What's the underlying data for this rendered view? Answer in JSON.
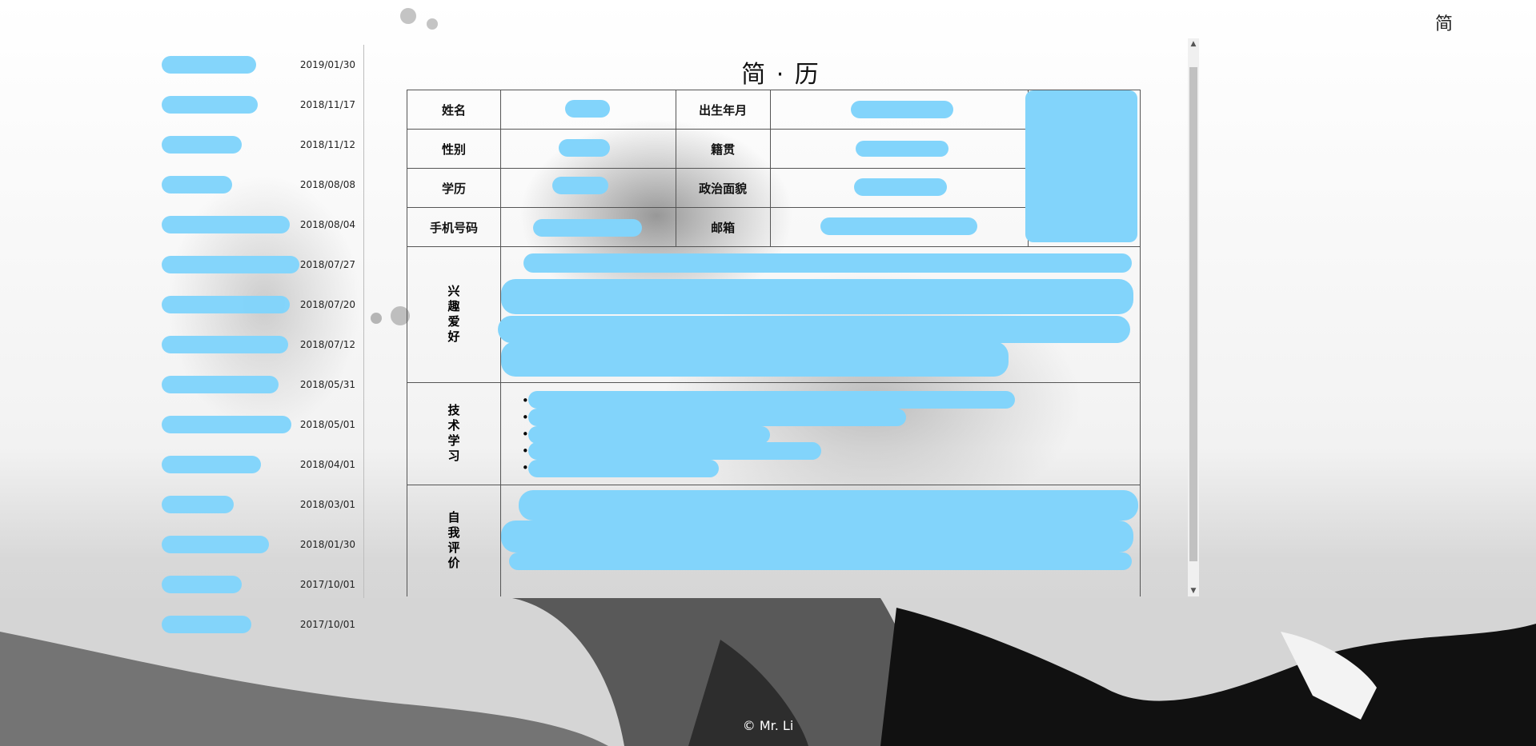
{
  "top_right_char": "简",
  "resume_title": "简 · 历",
  "sidebar": {
    "dates": [
      "2019/01/30",
      "2018/11/17",
      "2018/11/12",
      "2018/08/08",
      "2018/08/04",
      "2018/07/27",
      "2018/07/20",
      "2018/07/12",
      "2018/05/31",
      "2018/05/01",
      "2018/04/01",
      "2018/03/01",
      "2018/01/30",
      "2017/10/01",
      "2017/10/01"
    ]
  },
  "resume": {
    "labels": {
      "name": "姓名",
      "birth": "出生年月",
      "gender": "性别",
      "native_place": "籍贯",
      "education": "学历",
      "political_status": "政治面貌",
      "phone": "手机号码",
      "email": "邮箱",
      "hobbies": "兴趣爱好",
      "tech_study": "技术学习",
      "self_eval": "自我评价"
    }
  },
  "footer": "© Mr. Li",
  "colors": {
    "redaction": "#82d4fb",
    "ink": "#111111",
    "border": "#555555"
  }
}
